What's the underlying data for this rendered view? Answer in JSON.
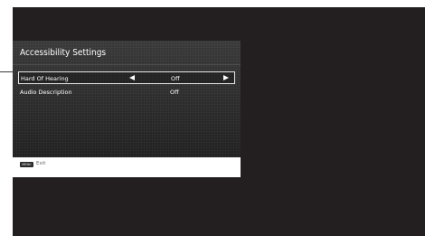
{
  "colors": {
    "screen_background": "#231f20",
    "panel_background": "#2c2c2c",
    "footer_background": "#ffffff",
    "text": "#ffffff",
    "selection_border": "#e8e8e8"
  },
  "panel": {
    "title": "Accessibility Settings"
  },
  "settings": [
    {
      "label": "Hard Of Hearing",
      "value": "Off",
      "selected": true,
      "left_icon": "arrow-left-icon",
      "right_icon": "arrow-right-icon"
    },
    {
      "label": "Audio Description",
      "value": "Off",
      "selected": false
    }
  ],
  "footer": {
    "key_label": "MENU",
    "key_icon": "menu-key-icon",
    "action_label": "Exit"
  }
}
